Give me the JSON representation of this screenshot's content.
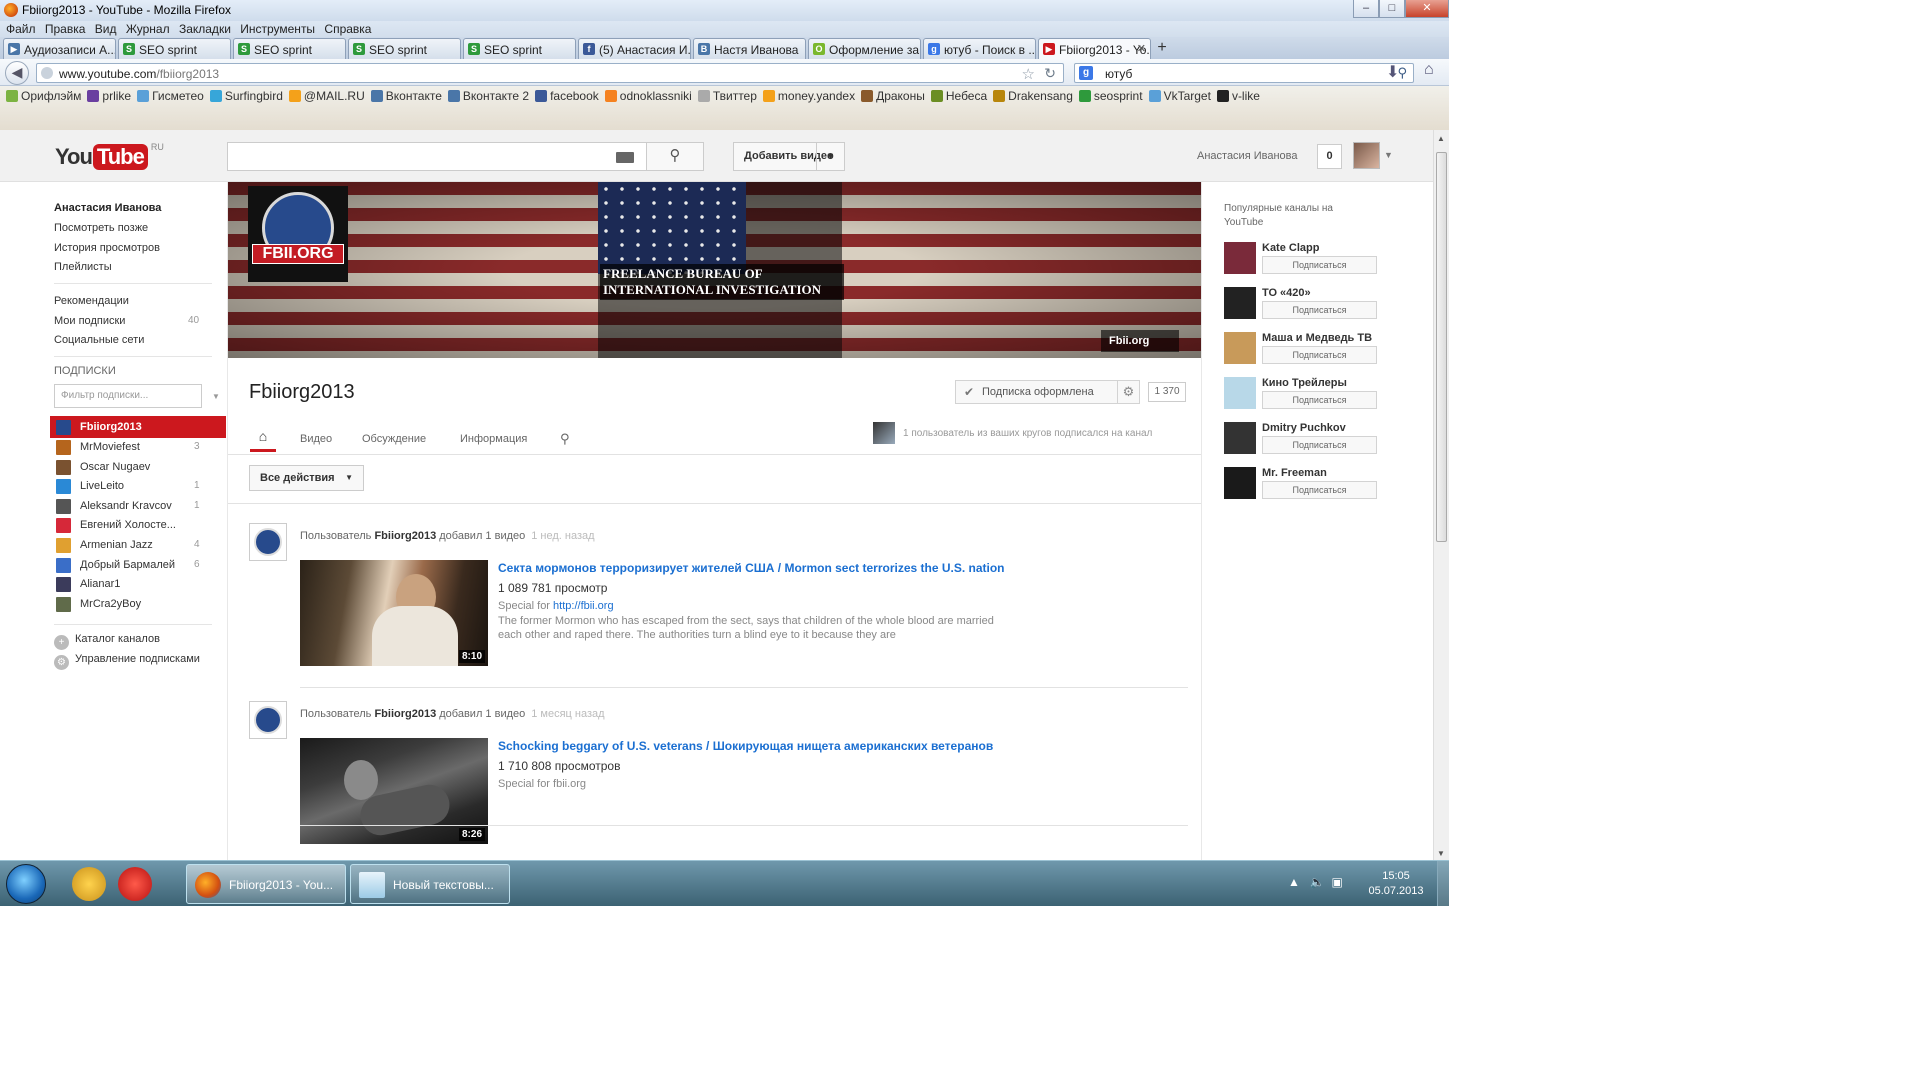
{
  "window": {
    "title": "Fbiiorg2013 - YouTube - Mozilla Firefox"
  },
  "menu": [
    "Файл",
    "Правка",
    "Вид",
    "Журнал",
    "Закладки",
    "Инструменты",
    "Справка"
  ],
  "tabs": [
    {
      "label": "Аудиозаписи А...",
      "color": "#4a76a8",
      "glyph": "▶"
    },
    {
      "label": "SEO sprint",
      "color": "#2e9a3c",
      "glyph": "S"
    },
    {
      "label": "SEO sprint",
      "color": "#2e9a3c",
      "glyph": "S"
    },
    {
      "label": "SEO sprint",
      "color": "#2e9a3c",
      "glyph": "S"
    },
    {
      "label": "SEO sprint",
      "color": "#2e9a3c",
      "glyph": "S"
    },
    {
      "label": "(5) Анастасия И...",
      "color": "#3b5998",
      "glyph": "f"
    },
    {
      "label": "Настя Иванова",
      "color": "#4a76a8",
      "glyph": "B"
    },
    {
      "label": "Оформление за...",
      "color": "#7bb82e",
      "glyph": "O"
    },
    {
      "label": "ютуб - Поиск в ...",
      "color": "#3b78e7",
      "glyph": "g"
    },
    {
      "label": "Fbiiorg2013 - Yo...",
      "color": "#cc181e",
      "glyph": "▶",
      "close": "✕"
    }
  ],
  "urlbar": {
    "host": "www.youtube.com",
    "path": "/fbiiorg2013"
  },
  "searchbar": {
    "engine": "g",
    "value": "ютуб"
  },
  "bookmarks": [
    {
      "label": "Орифлэйм",
      "color": "#7cb342"
    },
    {
      "label": "prlike",
      "color": "#6a3fa0",
      "glyph": "PR"
    },
    {
      "label": "Гисметео",
      "color": "#5aa0d8"
    },
    {
      "label": "Surfingbird",
      "color": "#37a6d9"
    },
    {
      "label": "@MAIL.RU",
      "color": "#f4a11a"
    },
    {
      "label": "Вконтакте",
      "color": "#4a76a8"
    },
    {
      "label": "Вконтакте 2",
      "color": "#4a76a8"
    },
    {
      "label": "facebook",
      "color": "#3b5998"
    },
    {
      "label": "odnoklassniki",
      "color": "#f58220"
    },
    {
      "label": "Твиттер",
      "color": "#aaaaaa"
    },
    {
      "label": "money.yandex",
      "color": "#f4a11a"
    },
    {
      "label": "Драконы",
      "color": "#8a5a2b"
    },
    {
      "label": "Небеса",
      "color": "#6b8e23"
    },
    {
      "label": "Drakensang",
      "color": "#b8860b"
    },
    {
      "label": "seosprint",
      "color": "#2e9a3c"
    },
    {
      "label": "VkTarget",
      "color": "#5aa0d8"
    },
    {
      "label": "v-like",
      "color": "#222222"
    }
  ],
  "yt": {
    "logo_you": "You",
    "logo_tube": "Tube",
    "logo_region": "RU",
    "upload_label": "Добавить видео",
    "user_name": "Анастасия Иванова",
    "notifications": "0",
    "guide": {
      "user": "Анастасия Иванова",
      "items": [
        "Посмотреть позже",
        "История просмотров",
        "Плейлисты"
      ],
      "items2": [
        {
          "label": "Рекомендации",
          "count": ""
        },
        {
          "label": "Мои подписки",
          "count": "40"
        },
        {
          "label": "Социальные сети",
          "count": ""
        }
      ],
      "subs_title": "ПОДПИСКИ",
      "filter_placeholder": "Фильтр подписки...",
      "subs": [
        {
          "name": "Fbiiorg2013",
          "count": "",
          "color": "#274a8c"
        },
        {
          "name": "MrMoviefest",
          "count": "3",
          "color": "#b5651d"
        },
        {
          "name": "Oscar Nugaev",
          "count": "",
          "color": "#7a5230"
        },
        {
          "name": "LiveLeito",
          "count": "1",
          "color": "#2a89d6"
        },
        {
          "name": "Aleksandr Kravcov",
          "count": "1",
          "color": "#555555"
        },
        {
          "name": "Евгений Холосте...",
          "count": "",
          "color": "#d62839"
        },
        {
          "name": "Armenian Jazz",
          "count": "4",
          "color": "#e0a030"
        },
        {
          "name": "Добрый Бармалей",
          "count": "6",
          "color": "#3a6ec8"
        },
        {
          "name": "Alianar1",
          "count": "",
          "color": "#3b3b5b"
        },
        {
          "name": "MrCra2yBoy",
          "count": "",
          "color": "#606b4a"
        }
      ],
      "actions": [
        "Каталог каналов",
        "Управление подписками"
      ]
    },
    "banner": {
      "title": "FREELANCE BUREAU OF INTERNATIONAL INVESTIGATION",
      "logo_text": "FBII.ORG",
      "site": "Fbii.org"
    },
    "channel": {
      "name": "Fbiiorg2013",
      "subscribed_label": "Подписка оформлена",
      "subscriber_count": "1 370",
      "tabs": [
        "Видео",
        "Обсуждение",
        "Информация"
      ],
      "circles_text": "1 пользователь из ваших кругов подписался на канал",
      "all_actions": "Все действия"
    },
    "feed": [
      {
        "prefix": "Пользователь",
        "user": "Fbiiorg2013",
        "action": "добавил 1 видео",
        "when": "1 нед. назад",
        "title": "Секта мормонов терроризирует жителей США / Mormon sect terrorizes the U.S. nation",
        "views": "1 089 781 просмотр",
        "special_prefix": "Special for",
        "special_link": "http://fbii.org",
        "desc": "The former Mormon who has escaped from the sect, says that children of the whole blood are married each other and raped there. The authorities turn a blind eye to it because they are",
        "duration": "8:10"
      },
      {
        "prefix": "Пользователь",
        "user": "Fbiiorg2013",
        "action": "добавил 1 видео",
        "when": "1 месяц назад",
        "title": "Schocking beggary of U.S. veterans / Шокирующая нищета американских ветеранов",
        "views": "1 710 808 просмотров",
        "special_prefix": "Special for fbii.org",
        "special_link": "",
        "desc": "",
        "duration": "8:26"
      }
    ],
    "rail": {
      "title": "Популярные каналы на YouTube",
      "button": "Подписаться",
      "channels": [
        {
          "name": "Kate Clapp",
          "color": "#7a2a3a"
        },
        {
          "name": "ТО «420»",
          "color": "#222222"
        },
        {
          "name": "Маша и Медведь ТВ",
          "color": "#c89a5a"
        },
        {
          "name": "Кино Трейлеры",
          "color": "#b8d8e8"
        },
        {
          "name": "Dmitry Puchkov",
          "color": "#333333"
        },
        {
          "name": "Mr. Freeman",
          "color": "#1a1a1a"
        }
      ]
    }
  },
  "taskbar": {
    "windows": [
      {
        "label": "Fbiiorg2013 - You..."
      },
      {
        "label": "Новый текстовы..."
      }
    ],
    "time": "15:05",
    "date": "05.07.2013"
  }
}
